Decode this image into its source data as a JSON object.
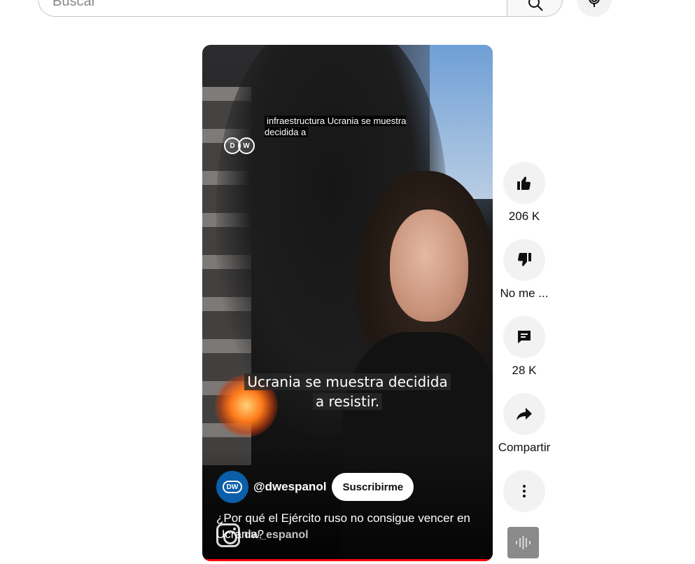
{
  "search": {
    "placeholder": "Buscar"
  },
  "video": {
    "top_caption": "infraestructura Ucrania se muestra decidida a",
    "subtitle_line1": "Ucrania se muestra decidida",
    "subtitle_line2": "a resistir.",
    "channel_handle": "@dwespanol",
    "subscribe_label": "Suscribirme",
    "title": "¿Por qué el Ejército ruso no consigue vencer en Ucrania?",
    "overlay_handle": "dw_espanol",
    "progress_fraction": 1.0
  },
  "actions": {
    "like_count": "206 K",
    "dislike_label": "No me ...",
    "comments_count": "28 K",
    "share_label": "Compartir"
  },
  "icons": [
    "search-icon",
    "mic-icon",
    "thumb-up-icon",
    "thumb-down-icon",
    "comment-icon",
    "share-icon",
    "more-vert-icon",
    "audio-waveform-icon",
    "instagram-icon",
    "dw-logo"
  ],
  "colors": {
    "progress": "#ff0000",
    "action_bg": "#f2f2f2",
    "dw_blue": "#0b5ea8"
  }
}
